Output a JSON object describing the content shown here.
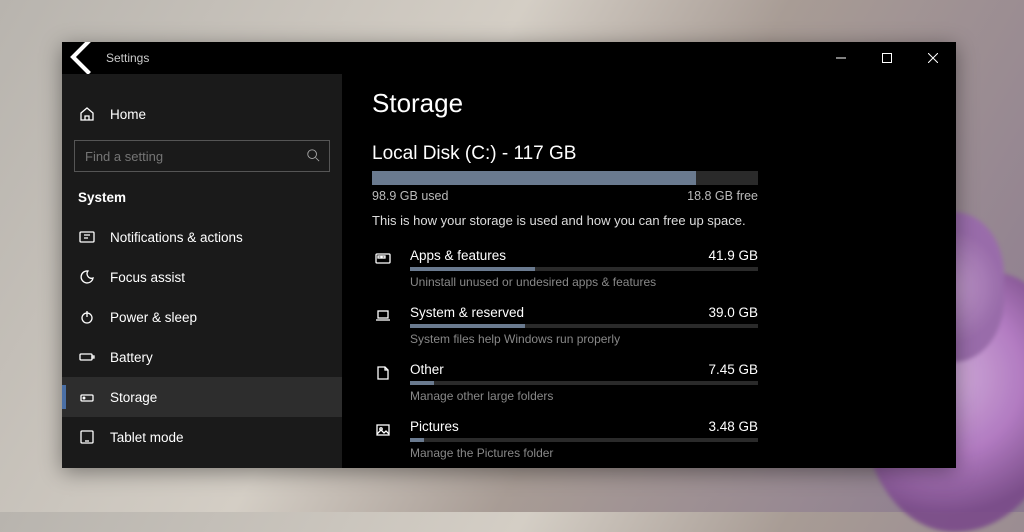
{
  "titlebar": {
    "title": "Settings"
  },
  "sidebar": {
    "home": "Home",
    "search_placeholder": "Find a setting",
    "section": "System",
    "items": [
      {
        "label": "Notifications & actions",
        "icon": "notifications"
      },
      {
        "label": "Focus assist",
        "icon": "moon"
      },
      {
        "label": "Power & sleep",
        "icon": "power"
      },
      {
        "label": "Battery",
        "icon": "battery"
      },
      {
        "label": "Storage",
        "icon": "storage",
        "selected": true
      },
      {
        "label": "Tablet mode",
        "icon": "tablet"
      }
    ]
  },
  "main": {
    "heading": "Storage",
    "disk_name": "Local Disk (C:) - 117 GB",
    "used_label": "98.9 GB used",
    "free_label": "18.8 GB free",
    "used_pct": 84,
    "desc": "This is how your storage is used and how you can free up space.",
    "items": [
      {
        "title": "Apps & features",
        "size": "41.9 GB",
        "sub": "Uninstall unused or undesired apps & features",
        "pct": 36,
        "icon": "apps"
      },
      {
        "title": "System & reserved",
        "size": "39.0 GB",
        "sub": "System files help Windows run properly",
        "pct": 33,
        "icon": "laptop"
      },
      {
        "title": "Other",
        "size": "7.45 GB",
        "sub": "Manage other large folders",
        "pct": 7,
        "icon": "other"
      },
      {
        "title": "Pictures",
        "size": "3.48 GB",
        "sub": "Manage the Pictures folder",
        "pct": 4,
        "icon": "pictures"
      }
    ]
  }
}
